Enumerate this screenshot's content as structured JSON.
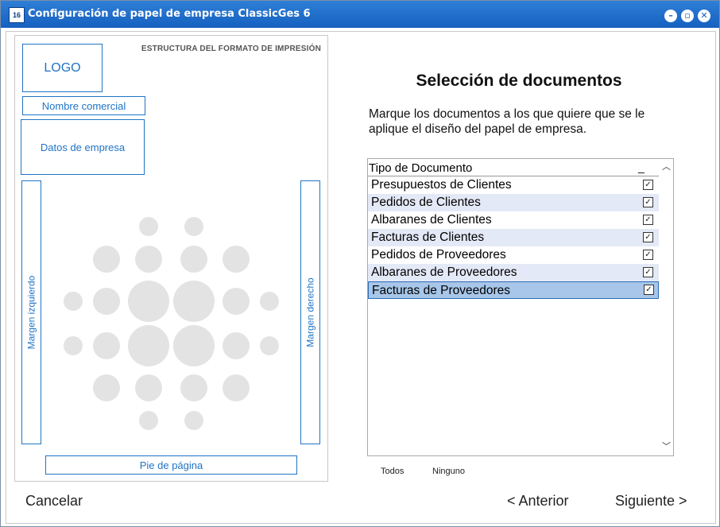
{
  "window": {
    "title": "Configuración de papel de empresa ClassicGes 6",
    "app_icon_text": "16",
    "controls": {
      "minimize": "–",
      "restore": "▫",
      "close": "✕"
    }
  },
  "preview": {
    "title": "ESTRUCTURA DEL FORMATO DE IMPRESIÓN",
    "logo": "LOGO",
    "nombre_comercial": "Nombre comercial",
    "datos_empresa": "Datos de empresa",
    "margen_izquierdo": "Margen izquierdo",
    "margen_derecho": "Margen derecho",
    "pie_pagina": "Pie de página"
  },
  "selection": {
    "heading": "Selección de documentos",
    "instructions": "Marque los documentos a los que quiere que se le aplique el diseño del papel de empresa.",
    "column_header": "Tipo de Documento",
    "column_header_extra": "_",
    "documents": [
      {
        "label": "Presupuestos de Clientes",
        "checked": true
      },
      {
        "label": "Pedidos de Clientes",
        "checked": true
      },
      {
        "label": "Albaranes de Clientes",
        "checked": true
      },
      {
        "label": "Facturas de Clientes",
        "checked": true
      },
      {
        "label": "Pedidos de Proveedores",
        "checked": true
      },
      {
        "label": "Albaranes de Proveedores",
        "checked": true
      },
      {
        "label": "Facturas de Proveedores",
        "checked": true,
        "selected": true
      }
    ],
    "select_all": "Todos",
    "select_none": "Ninguno"
  },
  "footer": {
    "cancel": "Cancelar",
    "previous": "< Anterior",
    "next": "Siguiente >"
  },
  "colors": {
    "titlebar": "#1560c0",
    "box_accent": "#1f74c6",
    "row_alt": "#e4e9f7",
    "row_selected": "#a7c6e9"
  }
}
